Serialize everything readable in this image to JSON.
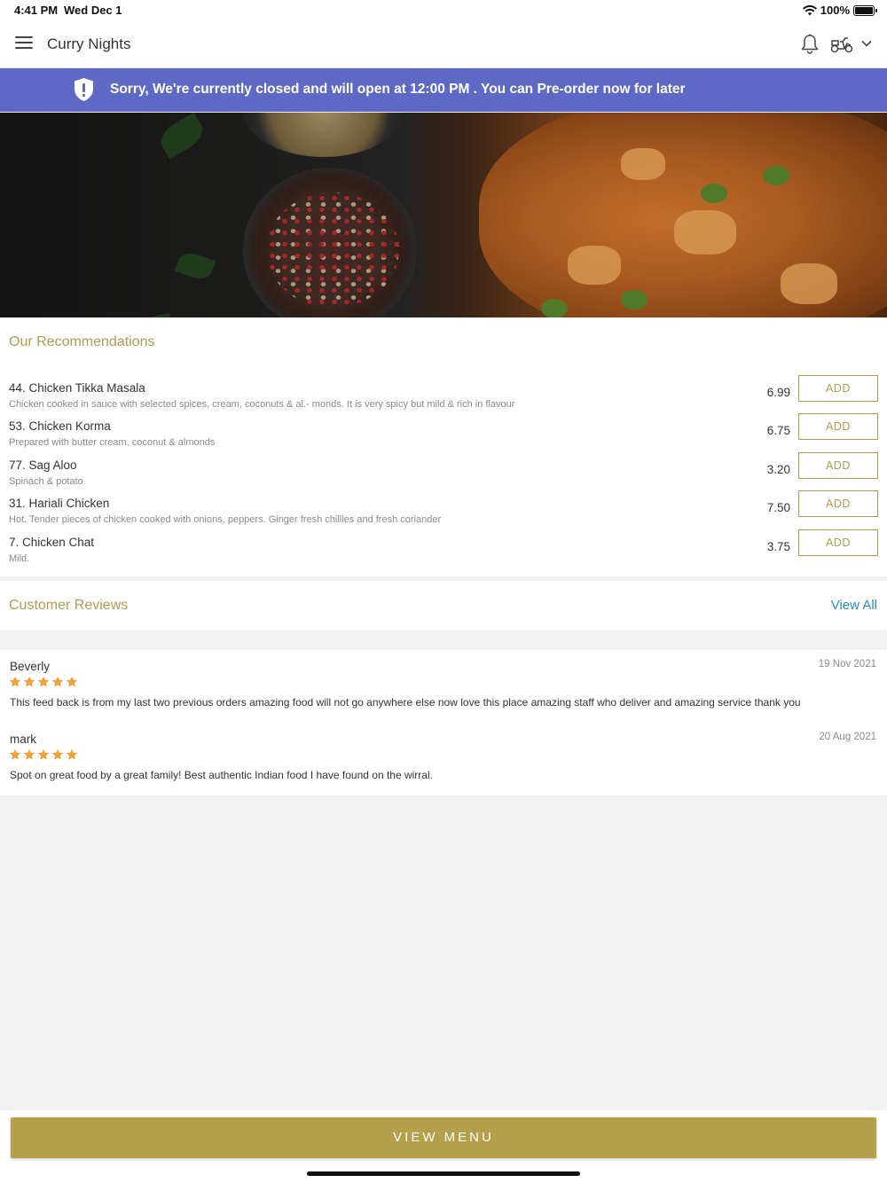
{
  "status_bar": {
    "time": "4:41 PM",
    "date": "Wed Dec 1",
    "battery": "100%",
    "battery_level": 1.0
  },
  "app_bar": {
    "title": "Curry Nights",
    "icons": [
      "menu-icon",
      "bell-icon",
      "scooter-icon",
      "chevron-down-icon"
    ]
  },
  "banner": {
    "message": "Sorry, We're currently closed and will open at 12:00 PM . You can Pre-order now for later",
    "icon": "shield-alert-icon",
    "color": "#5d69c4"
  },
  "recommendations": {
    "title": "Our Recommendations",
    "add_label": "ADD",
    "items": [
      {
        "name": "44. Chicken Tikka Masala",
        "description": "Chicken cooked in sauce with selected spices, cream, coconuts & al.- monds. It is very spicy but mild & rich in flavour",
        "price": "6.99"
      },
      {
        "name": "53. Chicken Korma",
        "description": "Prepared with butter cream, coconut & almonds",
        "price": "6.75"
      },
      {
        "name": "77. Sag Aloo",
        "description": "Spinach & potato",
        "price": "3.20"
      },
      {
        "name": "31. Hariali Chicken",
        "description": "Hot. Tender pieces of chicken cooked with onions, peppers. Ginger fresh chillies and fresh coriander",
        "price": "7.50"
      },
      {
        "name": "7. Chicken Chat",
        "description": "Mild.",
        "price": "3.75"
      }
    ]
  },
  "reviews": {
    "title": "Customer Reviews",
    "view_all": "View All",
    "items": [
      {
        "author": "Beverly",
        "date": "19 Nov 2021",
        "rating": 5,
        "text": "This feed back is from my last two previous orders amazing food will not go anywhere else now love this place amazing staff who deliver and amazing service thank you"
      },
      {
        "author": "mark",
        "date": "20 Aug 2021",
        "rating": 5,
        "text": "Spot on great food by a great family! Best authentic Indian food I have found on the wirral."
      }
    ]
  },
  "footer": {
    "view_menu": "VIEW MENU"
  },
  "colors": {
    "accent_gold": "#b4a04a",
    "section_title": "#b39a4e",
    "link_blue": "#2b8bbf",
    "star_orange": "#f2a03a"
  }
}
